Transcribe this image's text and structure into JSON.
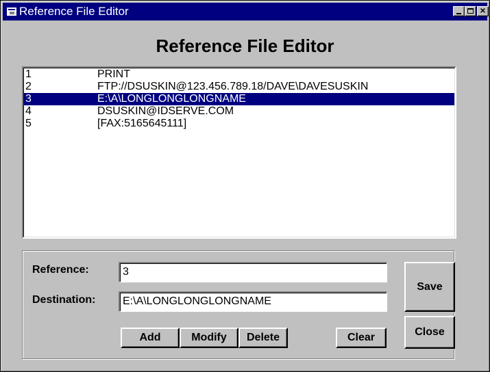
{
  "window": {
    "title": "Reference File Editor",
    "heading": "Reference File Editor"
  },
  "list": {
    "items": [
      {
        "num": "1",
        "text": "PRINT",
        "selected": false
      },
      {
        "num": "2",
        "text": "FTP://DSUSKIN@123.456.789.18/DAVE\\DAVESUSKIN",
        "selected": false
      },
      {
        "num": "3",
        "text": "E:\\A\\LONGLONGLONGNAME",
        "selected": true
      },
      {
        "num": "4",
        "text": "DSUSKIN@IDSERVE.COM",
        "selected": false
      },
      {
        "num": "5",
        "text": "[FAX:5165645111]",
        "selected": false
      }
    ]
  },
  "form": {
    "reference_label": "Reference:",
    "reference_value": "3",
    "destination_label": "Destination:",
    "destination_value": "E:\\A\\LONGLONGLONGNAME"
  },
  "buttons": {
    "add": "Add",
    "modify": "Modify",
    "delete": "Delete",
    "clear": "Clear",
    "save": "Save",
    "close": "Close"
  },
  "colors": {
    "face": "#c0c0c0",
    "titlebar": "#000080",
    "selection": "#000080"
  },
  "icons": {
    "app": "window-app-icon",
    "minimize": "minimize-icon",
    "maximize": "maximize-icon",
    "close": "close-icon"
  }
}
